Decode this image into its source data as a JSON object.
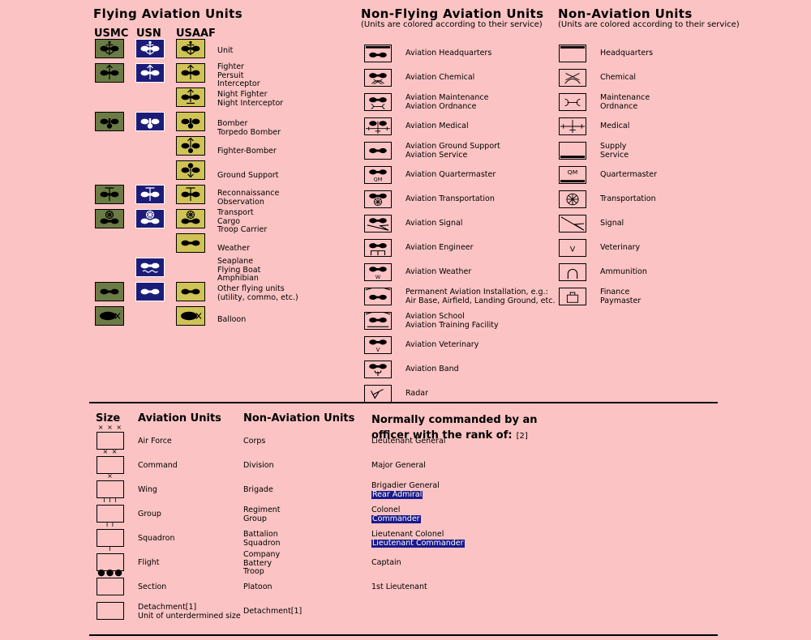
{
  "page": {
    "background": "#fbc3c3",
    "usmc_color": "#6b7b45",
    "usn_color": "#1c1c78",
    "usaaf_color": "#cfc355",
    "highlight_color": "#1a1a8c"
  },
  "flying": {
    "title": "Flying Aviation Units",
    "columns": [
      "USMC",
      "USN",
      "USAAF"
    ],
    "rows": [
      {
        "label": [
          "Unit"
        ],
        "usmc": "unit",
        "usn": "unit",
        "usaaf": "unit"
      },
      {
        "label": [
          "Fighter",
          "Persuit",
          "Interceptor"
        ],
        "usmc": "fighter",
        "usn": "fighter",
        "usaaf": "fighter"
      },
      {
        "label": [
          "Night Fighter",
          "Night Interceptor"
        ],
        "usmc": null,
        "usn": null,
        "usaaf": "nightfighter"
      },
      {
        "label": [
          "Bomber",
          "Torpedo Bomber"
        ],
        "usmc": "bomber",
        "usn": "bomber",
        "usaaf": "bomber"
      },
      {
        "label": [
          "Fighter-Bomber"
        ],
        "usmc": null,
        "usn": null,
        "usaaf": "fighterbomber"
      },
      {
        "label": [
          "Ground Support"
        ],
        "usmc": null,
        "usn": null,
        "usaaf": "groundsupport"
      },
      {
        "label": [
          "Reconnaissance",
          "Observation"
        ],
        "usmc": "recon",
        "usn": "recon",
        "usaaf": "recon"
      },
      {
        "label": [
          "Transport",
          "Cargo",
          "Troop Carrier"
        ],
        "usmc": "transport",
        "usn": "transport",
        "usaaf": "transport"
      },
      {
        "label": [
          "Weather"
        ],
        "usmc": null,
        "usn": null,
        "usaaf": "weather"
      },
      {
        "label": [
          "Seaplane",
          "Flying Boat",
          "Amphibian"
        ],
        "usmc": null,
        "usn": "seaplane",
        "usaaf": null
      },
      {
        "label": [
          "Other flying units",
          "(utility, commo, etc.)"
        ],
        "usmc": "other",
        "usn": "other",
        "usaaf": "other"
      },
      {
        "label": [
          "Balloon"
        ],
        "usmc": "balloon",
        "usn": null,
        "usaaf": "balloon"
      }
    ]
  },
  "nonflying": {
    "title": "Non-Flying Aviation Units",
    "subtitle": "(Units are colored according to their service)",
    "rows": [
      {
        "label": [
          "Aviation Headquarters"
        ],
        "glyph": "hq"
      },
      {
        "label": [
          "Aviation Chemical"
        ],
        "glyph": "chemical"
      },
      {
        "label": [
          "Aviation Maintenance",
          "Aviation Ordnance"
        ],
        "glyph": "maintenance"
      },
      {
        "label": [
          "Aviation Medical"
        ],
        "glyph": "medical"
      },
      {
        "label": [
          "Aviation Ground Support",
          "Aviation Service"
        ],
        "glyph": "service"
      },
      {
        "label": [
          "Aviation Quartermaster"
        ],
        "glyph": "quartermaster"
      },
      {
        "label": [
          "Aviation Transportation"
        ],
        "glyph": "transportation"
      },
      {
        "label": [
          "Aviation Signal"
        ],
        "glyph": "signal"
      },
      {
        "label": [
          "Aviation Engineer"
        ],
        "glyph": "engineer"
      },
      {
        "label": [
          "Aviation Weather"
        ],
        "glyph": "weather"
      },
      {
        "label": [
          "Permanent Aviation Installation, e.g.:",
          "Air Base, Airfield, Landing Ground, etc."
        ],
        "glyph": "installation"
      },
      {
        "label": [
          "Aviation School",
          "Aviation Training Facility"
        ],
        "glyph": "school"
      },
      {
        "label": [
          "Aviation Veterinary"
        ],
        "glyph": "veterinary"
      },
      {
        "label": [
          "Aviation Band"
        ],
        "glyph": "band"
      },
      {
        "label": [
          "Radar"
        ],
        "glyph": "radar"
      }
    ]
  },
  "nonaviation": {
    "title": "Non-Aviation Units",
    "subtitle": "(Units are colored according to their service)",
    "rows": [
      {
        "label": [
          "Headquarters"
        ],
        "glyph": "hq"
      },
      {
        "label": [
          "Chemical"
        ],
        "glyph": "chemical"
      },
      {
        "label": [
          "Maintenance",
          "Ordnance"
        ],
        "glyph": "maintenance"
      },
      {
        "label": [
          "Medical"
        ],
        "glyph": "medical"
      },
      {
        "label": [
          "Supply",
          "Service"
        ],
        "glyph": "supply"
      },
      {
        "label": [
          "Quartermaster"
        ],
        "glyph": "quartermaster"
      },
      {
        "label": [
          "Transportation"
        ],
        "glyph": "transportation"
      },
      {
        "label": [
          "Signal"
        ],
        "glyph": "signal"
      },
      {
        "label": [
          "Veterinary"
        ],
        "glyph": "veterinary"
      },
      {
        "label": [
          "Ammunition"
        ],
        "glyph": "ammunition"
      },
      {
        "label": [
          "Finance",
          "Paymaster"
        ],
        "glyph": "finance"
      }
    ]
  },
  "sizetable": {
    "headers": {
      "size": "Size",
      "aviation": "Aviation Units",
      "nonaviation": "Non-Aviation Units",
      "rank_line1": "Normally commanded by an",
      "rank_line2": "officer with the rank of:",
      "rank_note": "[2]"
    },
    "rows": [
      {
        "mark": "× × ×",
        "marktype": "text",
        "aviation": [
          "Air Force"
        ],
        "nonaviation": [
          "Corps"
        ],
        "rank": [
          "Lieutenant General"
        ],
        "rank_hl": []
      },
      {
        "mark": "× ×",
        "marktype": "text",
        "aviation": [
          "Command"
        ],
        "nonaviation": [
          "Division"
        ],
        "rank": [
          "Major General"
        ],
        "rank_hl": []
      },
      {
        "mark": "×",
        "marktype": "text",
        "aviation": [
          "Wing"
        ],
        "nonaviation": [
          "Brigade"
        ],
        "rank": [
          "Brigadier General"
        ],
        "rank_hl": [
          "Rear Admiral"
        ]
      },
      {
        "mark": "I I I",
        "marktype": "text",
        "aviation": [
          "Group"
        ],
        "nonaviation": [
          "Regiment",
          "Group"
        ],
        "rank": [
          "Colonel"
        ],
        "rank_hl": [
          "Commander"
        ]
      },
      {
        "mark": "I I",
        "marktype": "text",
        "aviation": [
          "Squadron"
        ],
        "nonaviation": [
          "Battalion",
          "Squadron"
        ],
        "rank": [
          "Lieutenant  Colonel"
        ],
        "rank_hl": [
          "Lieutenant Commander"
        ]
      },
      {
        "mark": "I",
        "marktype": "text",
        "aviation": [
          "Flight"
        ],
        "nonaviation": [
          "Company",
          "Battery",
          "Troop"
        ],
        "rank": [
          "Captain"
        ],
        "rank_hl": []
      },
      {
        "mark": "●●●",
        "marktype": "dots",
        "aviation": [
          "Section"
        ],
        "nonaviation": [
          "Platoon"
        ],
        "rank": [
          "1st Lieutenant"
        ],
        "rank_hl": []
      },
      {
        "mark": "",
        "marktype": "none",
        "aviation": [
          "Detachment[1]",
          "Unit of unterdermined size"
        ],
        "nonaviation": [
          "Detachment[1]"
        ],
        "rank": [],
        "rank_hl": []
      }
    ]
  }
}
